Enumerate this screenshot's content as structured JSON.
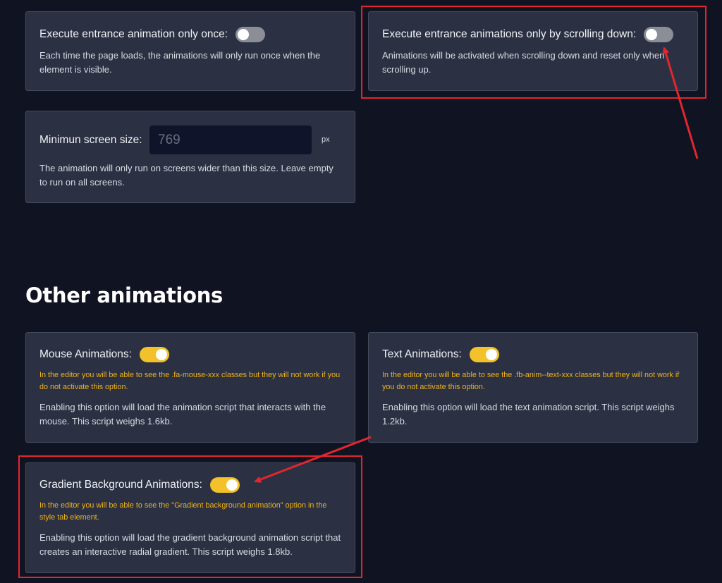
{
  "entrance": {
    "once": {
      "label": "Execute entrance animation only once:",
      "enabled": false,
      "description": "Each time the page loads, the animations will only run once when the element is visible."
    },
    "scroll_down": {
      "label": "Execute entrance animations only by scrolling down:",
      "enabled": false,
      "description": "Animations will be activated when scrolling down and reset only when scrolling up."
    },
    "min_screen": {
      "label": "Minimun screen size:",
      "placeholder": "769",
      "value": "",
      "unit": "px",
      "description": "The animation will only run on screens wider than this size. Leave empty to run on all screens."
    }
  },
  "other": {
    "title": "Other animations",
    "mouse": {
      "label": "Mouse Animations:",
      "enabled": true,
      "warning": "In the editor you will be able to see the .fa-mouse-xxx classes but they will not work if you do not activate this option.",
      "description": "Enabling this option will load the animation script that interacts with the mouse. This script weighs 1.6kb."
    },
    "text": {
      "label": "Text Animations:",
      "enabled": true,
      "warning": "In the editor you will be able to see the .fb-anim--text-xxx classes but they will not work if you do not activate this option.",
      "description": "Enabling this option will load the text animation script. This script weighs 1.2kb."
    },
    "gradient": {
      "label": "Gradient Background Animations:",
      "enabled": true,
      "warning": "In the editor you will be able to see the \"Gradient background animation\" option in the style tab element.",
      "description": "Enabling this option will load the gradient background animation script that creates an interactive radial gradient. This script weighs 1.8kb."
    }
  },
  "colors": {
    "background": "#0f1322",
    "card": "#2b3042",
    "toggle_on": "#f3c12a",
    "toggle_off": "#8b8e97",
    "warning": "#f1b318",
    "annotation": "#e3262e"
  }
}
